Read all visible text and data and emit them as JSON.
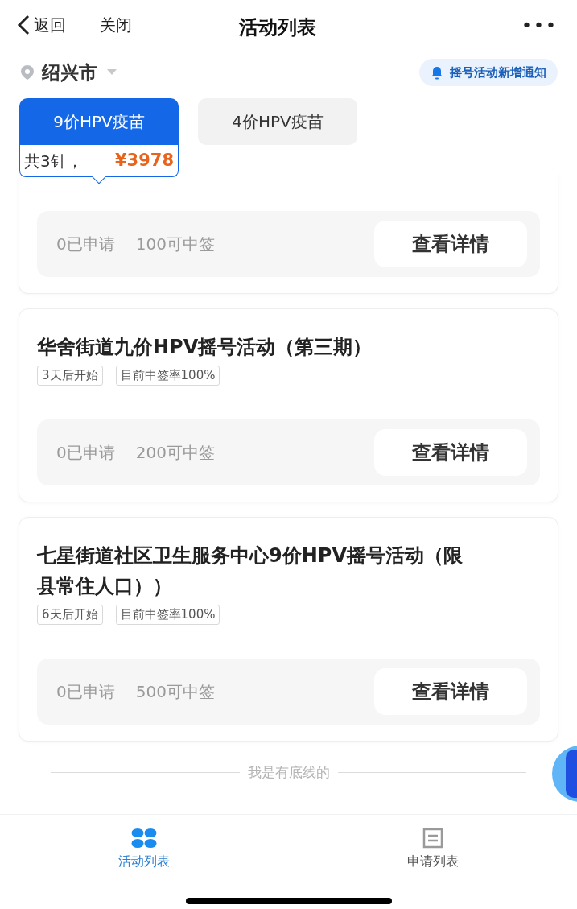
{
  "header": {
    "back": "返回",
    "close": "关闭",
    "title": "活动列表",
    "more": "•••"
  },
  "location": {
    "city": "绍兴市",
    "notify": "摇号活动新增通知"
  },
  "tabs": [
    {
      "label": "9价HPV疫苗",
      "selected": true
    },
    {
      "label": "4价HPV疫苗",
      "selected": false
    }
  ],
  "dose_info": {
    "text": "共3针，",
    "price": "¥3978"
  },
  "activities": [
    {
      "applied": "0已申请",
      "quota": "100可中签",
      "button": "查看详情"
    },
    {
      "title": "华舍街道九价HPV摇号活动（第三期）",
      "tags": [
        "3天后开始",
        "目前中签率100%"
      ],
      "applied": "0已申请",
      "quota": "200可中签",
      "button": "查看详情"
    },
    {
      "title": "七星街道社区卫生服务中心9价HPV摇号活动（限县常住人口））",
      "tags": [
        "6天后开始",
        "目前中签率100%"
      ],
      "applied": "0已申请",
      "quota": "500可中签",
      "button": "查看详情"
    }
  ],
  "end_note": "我是有底线的",
  "bottom_nav": [
    {
      "label": "活动列表",
      "selected": true,
      "kind": "grid"
    },
    {
      "label": "申请列表",
      "selected": false,
      "kind": "list"
    }
  ]
}
